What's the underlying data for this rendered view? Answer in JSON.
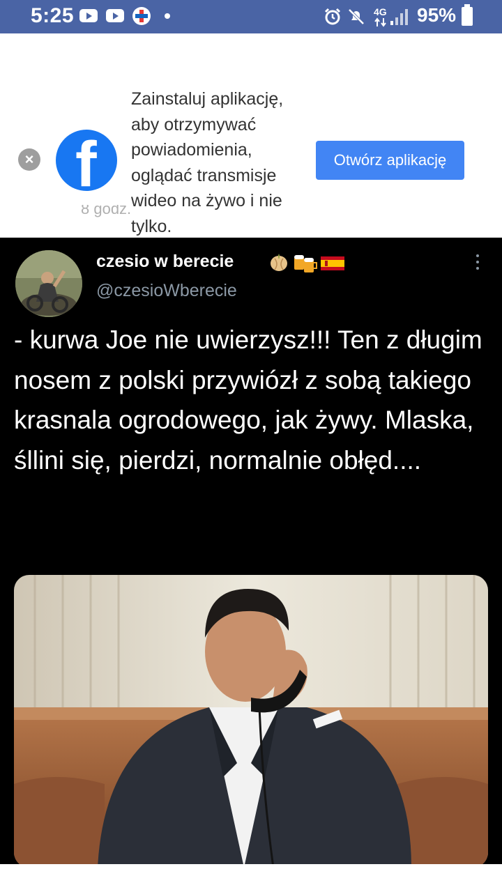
{
  "status_bar": {
    "time": "5:25",
    "network": "4G",
    "battery": "95%",
    "icons": [
      "youtube-icon",
      "youtube-icon",
      "medical-app-icon",
      "notification-dot-icon",
      "alarm-icon",
      "mute-icon",
      "signal-icon",
      "battery-icon"
    ]
  },
  "banner": {
    "close_label": "×",
    "logo_letter": "f",
    "message": "Zainstaluj aplikację, aby otrzymywać powiadomienia, oglądać transmisje wideo na żywo i nie tylko.",
    "open_button": "Otwórz aplikację",
    "peek_text": "8 godz."
  },
  "tweet": {
    "display_name": "czesio w berecie",
    "handle": "@czesioWberecie",
    "text": "- kurwa Joe nie uwierzysz!!! Ten z długim nosem z polski przywiózł z sobą takiego krasnala ogrodowego, jak żywy. Mlaska, śllini się, pierdzi, normalnie obłęd....",
    "name_emojis": [
      "onion-emoji",
      "beer-mugs-emoji",
      "spain-flag-emoji"
    ]
  },
  "colors": {
    "status_bar": "#4a64a5",
    "facebook_blue": "#1877f2",
    "button_blue": "#4285f4",
    "tweet_bg": "#000000",
    "handle_gray": "#8b98a5"
  }
}
